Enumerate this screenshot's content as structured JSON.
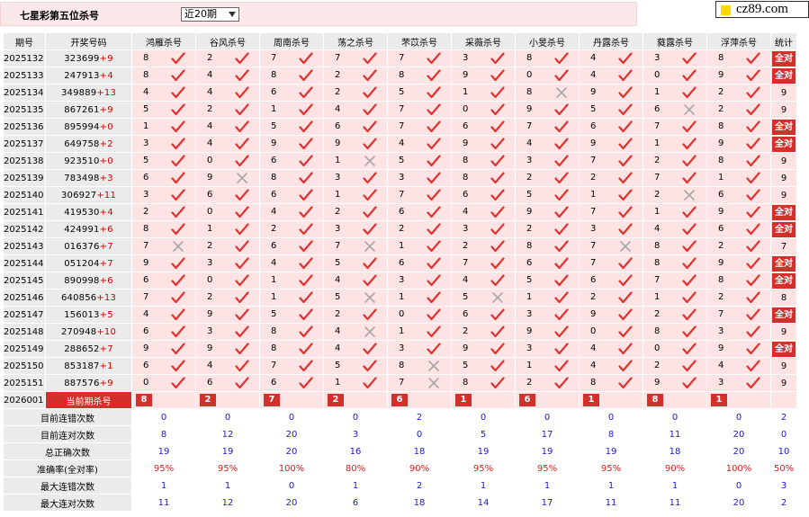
{
  "header": {
    "title": "七星彩第五位杀号",
    "period_select": "近20期",
    "brand": "cz89.com"
  },
  "columns": {
    "period": "期号",
    "draw": "开奖号码",
    "experts": [
      "鸿雁杀号",
      "谷风杀号",
      "周南杀号",
      "荡之杀号",
      "芣苡杀号",
      "采薇杀号",
      "小旻杀号",
      "丹露杀号",
      "蕤露杀号",
      "浮萍杀号"
    ],
    "stat": "统计"
  },
  "rows": [
    {
      "period": "2025132",
      "digits": "323699",
      "sum": "+9",
      "kills": [
        [
          8,
          1
        ],
        [
          2,
          1
        ],
        [
          7,
          1
        ],
        [
          7,
          1
        ],
        [
          7,
          1
        ],
        [
          3,
          1
        ],
        [
          8,
          1
        ],
        [
          4,
          1
        ],
        [
          3,
          1
        ],
        [
          8,
          1
        ]
      ],
      "stat": "全对"
    },
    {
      "period": "2025133",
      "digits": "247913",
      "sum": "+4",
      "kills": [
        [
          8,
          1
        ],
        [
          4,
          1
        ],
        [
          8,
          1
        ],
        [
          2,
          1
        ],
        [
          8,
          1
        ],
        [
          9,
          1
        ],
        [
          0,
          1
        ],
        [
          4,
          1
        ],
        [
          0,
          1
        ],
        [
          9,
          1
        ]
      ],
      "stat": "全对"
    },
    {
      "period": "2025134",
      "digits": "349889",
      "sum": "+13",
      "kills": [
        [
          4,
          1
        ],
        [
          4,
          1
        ],
        [
          6,
          1
        ],
        [
          2,
          1
        ],
        [
          5,
          1
        ],
        [
          1,
          1
        ],
        [
          8,
          0
        ],
        [
          9,
          1
        ],
        [
          1,
          1
        ],
        [
          2,
          1
        ]
      ],
      "stat": "9"
    },
    {
      "period": "2025135",
      "digits": "867261",
      "sum": "+9",
      "kills": [
        [
          5,
          1
        ],
        [
          2,
          1
        ],
        [
          1,
          1
        ],
        [
          4,
          1
        ],
        [
          7,
          1
        ],
        [
          0,
          1
        ],
        [
          9,
          1
        ],
        [
          5,
          1
        ],
        [
          6,
          0
        ],
        [
          2,
          1
        ]
      ],
      "stat": "9"
    },
    {
      "period": "2025136",
      "digits": "895994",
      "sum": "+0",
      "kills": [
        [
          1,
          1
        ],
        [
          4,
          1
        ],
        [
          5,
          1
        ],
        [
          6,
          1
        ],
        [
          7,
          1
        ],
        [
          6,
          1
        ],
        [
          7,
          1
        ],
        [
          6,
          1
        ],
        [
          7,
          1
        ],
        [
          8,
          1
        ]
      ],
      "stat": "全对"
    },
    {
      "period": "2025137",
      "digits": "649758",
      "sum": "+2",
      "kills": [
        [
          3,
          1
        ],
        [
          4,
          1
        ],
        [
          9,
          1
        ],
        [
          9,
          1
        ],
        [
          4,
          1
        ],
        [
          9,
          1
        ],
        [
          4,
          1
        ],
        [
          9,
          1
        ],
        [
          1,
          1
        ],
        [
          9,
          1
        ]
      ],
      "stat": "全对"
    },
    {
      "period": "2025138",
      "digits": "923510",
      "sum": "+0",
      "kills": [
        [
          5,
          1
        ],
        [
          0,
          1
        ],
        [
          6,
          1
        ],
        [
          1,
          0
        ],
        [
          5,
          1
        ],
        [
          8,
          1
        ],
        [
          3,
          1
        ],
        [
          7,
          1
        ],
        [
          2,
          1
        ],
        [
          8,
          1
        ]
      ],
      "stat": "9"
    },
    {
      "period": "2025139",
      "digits": "783498",
      "sum": "+3",
      "kills": [
        [
          6,
          1
        ],
        [
          9,
          0
        ],
        [
          8,
          1
        ],
        [
          3,
          1
        ],
        [
          3,
          1
        ],
        [
          8,
          1
        ],
        [
          2,
          1
        ],
        [
          2,
          1
        ],
        [
          7,
          1
        ],
        [
          1,
          1
        ]
      ],
      "stat": "9"
    },
    {
      "period": "2025140",
      "digits": "306927",
      "sum": "+11",
      "kills": [
        [
          3,
          1
        ],
        [
          6,
          1
        ],
        [
          6,
          1
        ],
        [
          1,
          1
        ],
        [
          7,
          1
        ],
        [
          6,
          1
        ],
        [
          5,
          1
        ],
        [
          1,
          1
        ],
        [
          2,
          0
        ],
        [
          6,
          1
        ]
      ],
      "stat": "9"
    },
    {
      "period": "2025141",
      "digits": "419530",
      "sum": "+4",
      "kills": [
        [
          2,
          1
        ],
        [
          0,
          1
        ],
        [
          4,
          1
        ],
        [
          2,
          1
        ],
        [
          6,
          1
        ],
        [
          4,
          1
        ],
        [
          9,
          1
        ],
        [
          7,
          1
        ],
        [
          1,
          1
        ],
        [
          9,
          1
        ]
      ],
      "stat": "全对"
    },
    {
      "period": "2025142",
      "digits": "424991",
      "sum": "+6",
      "kills": [
        [
          8,
          1
        ],
        [
          1,
          1
        ],
        [
          2,
          1
        ],
        [
          3,
          1
        ],
        [
          2,
          1
        ],
        [
          3,
          1
        ],
        [
          2,
          1
        ],
        [
          3,
          1
        ],
        [
          4,
          1
        ],
        [
          6,
          1
        ]
      ],
      "stat": "全对"
    },
    {
      "period": "2025143",
      "digits": "016376",
      "sum": "+7",
      "kills": [
        [
          7,
          0
        ],
        [
          2,
          1
        ],
        [
          6,
          1
        ],
        [
          7,
          0
        ],
        [
          1,
          1
        ],
        [
          2,
          1
        ],
        [
          8,
          1
        ],
        [
          7,
          0
        ],
        [
          8,
          1
        ],
        [
          2,
          1
        ]
      ],
      "stat": "7"
    },
    {
      "period": "2025144",
      "digits": "051204",
      "sum": "+7",
      "kills": [
        [
          9,
          1
        ],
        [
          3,
          1
        ],
        [
          4,
          1
        ],
        [
          5,
          1
        ],
        [
          6,
          1
        ],
        [
          7,
          1
        ],
        [
          6,
          1
        ],
        [
          7,
          1
        ],
        [
          8,
          1
        ],
        [
          9,
          1
        ]
      ],
      "stat": "全对"
    },
    {
      "period": "2025145",
      "digits": "890998",
      "sum": "+6",
      "kills": [
        [
          6,
          1
        ],
        [
          0,
          1
        ],
        [
          1,
          1
        ],
        [
          4,
          1
        ],
        [
          3,
          1
        ],
        [
          4,
          1
        ],
        [
          5,
          1
        ],
        [
          6,
          1
        ],
        [
          7,
          1
        ],
        [
          8,
          1
        ]
      ],
      "stat": "全对"
    },
    {
      "period": "2025146",
      "digits": "640856",
      "sum": "+13",
      "kills": [
        [
          7,
          1
        ],
        [
          2,
          1
        ],
        [
          1,
          1
        ],
        [
          5,
          0
        ],
        [
          1,
          1
        ],
        [
          5,
          0
        ],
        [
          1,
          1
        ],
        [
          2,
          1
        ],
        [
          1,
          1
        ],
        [
          2,
          1
        ]
      ],
      "stat": "8"
    },
    {
      "period": "2025147",
      "digits": "156013",
      "sum": "+5",
      "kills": [
        [
          4,
          1
        ],
        [
          9,
          1
        ],
        [
          5,
          1
        ],
        [
          2,
          1
        ],
        [
          0,
          1
        ],
        [
          6,
          1
        ],
        [
          3,
          1
        ],
        [
          9,
          1
        ],
        [
          2,
          1
        ],
        [
          7,
          1
        ]
      ],
      "stat": "全对"
    },
    {
      "period": "2025148",
      "digits": "270948",
      "sum": "+10",
      "kills": [
        [
          6,
          1
        ],
        [
          3,
          1
        ],
        [
          8,
          1
        ],
        [
          4,
          0
        ],
        [
          1,
          1
        ],
        [
          2,
          1
        ],
        [
          9,
          1
        ],
        [
          0,
          1
        ],
        [
          8,
          1
        ],
        [
          3,
          1
        ]
      ],
      "stat": "9"
    },
    {
      "period": "2025149",
      "digits": "288652",
      "sum": "+7",
      "kills": [
        [
          9,
          1
        ],
        [
          9,
          1
        ],
        [
          8,
          1
        ],
        [
          4,
          1
        ],
        [
          3,
          1
        ],
        [
          9,
          1
        ],
        [
          3,
          1
        ],
        [
          4,
          1
        ],
        [
          0,
          1
        ],
        [
          9,
          1
        ]
      ],
      "stat": "全对"
    },
    {
      "period": "2025150",
      "digits": "853187",
      "sum": "+1",
      "kills": [
        [
          6,
          1
        ],
        [
          4,
          1
        ],
        [
          7,
          1
        ],
        [
          5,
          1
        ],
        [
          8,
          0
        ],
        [
          5,
          1
        ],
        [
          1,
          1
        ],
        [
          4,
          1
        ],
        [
          2,
          1
        ],
        [
          4,
          1
        ]
      ],
      "stat": "9"
    },
    {
      "period": "2025151",
      "digits": "887576",
      "sum": "+9",
      "kills": [
        [
          0,
          1
        ],
        [
          6,
          1
        ],
        [
          6,
          1
        ],
        [
          1,
          1
        ],
        [
          7,
          0
        ],
        [
          8,
          1
        ],
        [
          2,
          1
        ],
        [
          8,
          1
        ],
        [
          9,
          1
        ],
        [
          3,
          1
        ]
      ],
      "stat": "9"
    }
  ],
  "current": {
    "period": "2026001",
    "label": "当前期杀号",
    "kills": [
      "8",
      "2",
      "7",
      "2",
      "6",
      "1",
      "6",
      "1",
      "8",
      "1"
    ]
  },
  "summary": [
    {
      "label": "目前连错次数",
      "values": [
        "0",
        "0",
        "0",
        "0",
        "2",
        "0",
        "0",
        "0",
        "0",
        "0"
      ],
      "stat": "2",
      "red": false
    },
    {
      "label": "目前连对次数",
      "values": [
        "8",
        "12",
        "20",
        "3",
        "0",
        "5",
        "17",
        "8",
        "11",
        "20"
      ],
      "stat": "0",
      "red": false
    },
    {
      "label": "总正确次数",
      "values": [
        "19",
        "19",
        "20",
        "16",
        "18",
        "19",
        "19",
        "19",
        "18",
        "20"
      ],
      "stat": "10",
      "red": false
    },
    {
      "label": "准确率(全对率)",
      "values": [
        "95%",
        "95%",
        "100%",
        "80%",
        "90%",
        "95%",
        "95%",
        "95%",
        "90%",
        "100%"
      ],
      "stat": "50%",
      "red": true
    },
    {
      "label": "最大连错次数",
      "values": [
        "1",
        "1",
        "0",
        "1",
        "2",
        "1",
        "1",
        "1",
        "1",
        "0"
      ],
      "stat": "3",
      "red": false
    },
    {
      "label": "最大连对次数",
      "values": [
        "11",
        "12",
        "20",
        "6",
        "18",
        "14",
        "17",
        "11",
        "11",
        "20"
      ],
      "stat": "2",
      "red": false
    }
  ],
  "colors": {
    "accent": "#d3302c",
    "pair_bg": "#fde3e3",
    "label_bg": "#ebebeb",
    "ok": "#e0322f",
    "miss": "#a8a8a8",
    "value_blue": "#1a1ad8"
  }
}
